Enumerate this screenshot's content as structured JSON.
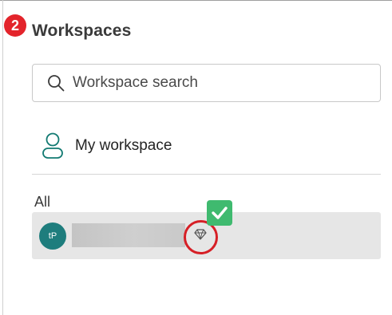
{
  "step": {
    "number": "2",
    "color": "#e3242b"
  },
  "panel": {
    "title": "Workspaces"
  },
  "search": {
    "placeholder": "Workspace search",
    "value": "",
    "icon": "search-icon"
  },
  "my_workspace": {
    "label": "My workspace",
    "icon": "person-icon",
    "icon_color": "#127a72"
  },
  "workspace_list": {
    "section_label": "All",
    "items": [
      {
        "avatar_initials": "tP",
        "avatar_color": "#1e7d7d",
        "name_redacted": true,
        "badge_icon": "diamond-premium-icon",
        "selected": true
      }
    ]
  },
  "annotation": {
    "highlight_color": "#d61f26",
    "check_icon": "checkmark-icon",
    "check_color": "#3fba6f"
  }
}
